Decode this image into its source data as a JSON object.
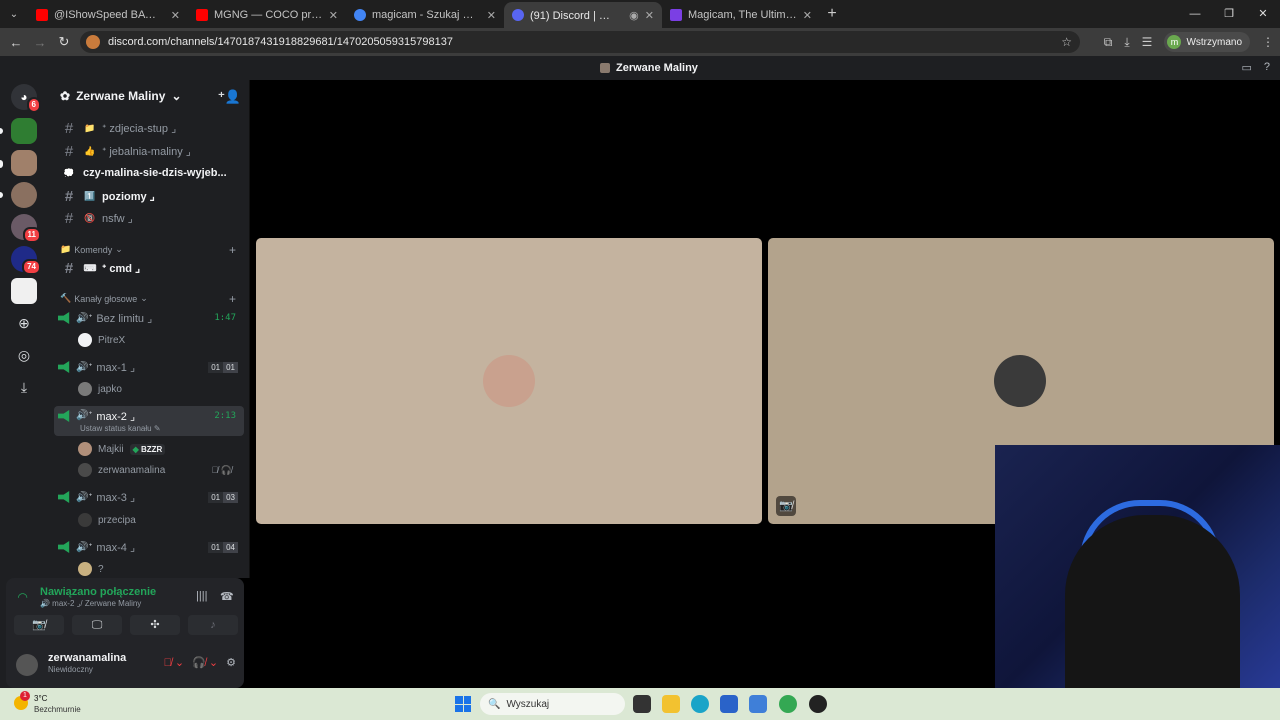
{
  "browser": {
    "tabs": [
      {
        "title": "@IShowSpeed BAWI SIĘ W WA",
        "color": "#ff0000"
      },
      {
        "title": "MGNG — COCO prod. MRGH",
        "color": "#ff0000"
      },
      {
        "title": "magicam - Szukaj w Google",
        "color": "#4285f4"
      },
      {
        "title": "(91) Discord | 🔊 max-2",
        "color": "#5865f2"
      },
      {
        "title": "Magicam, The Ultimate Real-Tim",
        "color": "#7b3fe4"
      }
    ],
    "url": "discord.com/channels/1470187431918829681/1470205059315798137",
    "profile_label": "Wstrzymano",
    "profile_initial": "m"
  },
  "discord": {
    "top_title": "Zerwane Maliny",
    "servers": [
      {
        "badge": "6"
      },
      {
        "badge": ""
      },
      {
        "badge": ""
      },
      {
        "badge": "11"
      },
      {
        "badge": "74"
      }
    ],
    "guild_name": "Zerwane Maliny",
    "text_channels": [
      {
        "emoji": "📁",
        "name": "ᐩ zdjecia-stup ⌟",
        "bold": false
      },
      {
        "emoji": "👍",
        "name": "ᐩ jebalnia-maliny ⌟",
        "bold": false
      },
      {
        "emoji": "💭",
        "name": "czy-malina-sie-dzis-wyjeb...",
        "bold": true
      },
      {
        "emoji": "1️⃣",
        "name": "poziomy ⌟",
        "bold": true
      },
      {
        "emoji": "🔞",
        "name": "nsfw ⌟",
        "bold": false
      }
    ],
    "category_commands": "Komendy",
    "cmd_channel": "ᐩ cmd ⌟",
    "category_voice": "Kanały głosowe",
    "voice_channels": [
      {
        "name": "Bez limitu ⌟",
        "timer": "1:47",
        "count": [],
        "users": [
          {
            "name": "PitreX"
          }
        ]
      },
      {
        "name": "max-1 ⌟",
        "timer": "",
        "count": [
          "01",
          "01"
        ],
        "users": [
          {
            "name": "japko"
          }
        ]
      },
      {
        "name": "max-2 ⌟",
        "timer": "2:13",
        "count": [],
        "status": "Ustaw status kanału",
        "users": [
          {
            "name": "Majkii",
            "tag": "BZZR"
          },
          {
            "name": "zerwanamalina"
          }
        ]
      },
      {
        "name": "max-3 ⌟",
        "timer": "",
        "count": [
          "01",
          "03"
        ],
        "users": [
          {
            "name": "przecipa"
          }
        ]
      },
      {
        "name": "max-4 ⌟",
        "timer": "",
        "count": [
          "01",
          "04"
        ],
        "users": [
          {
            "name": "?"
          }
        ]
      }
    ],
    "voice_panel": {
      "status": "Nawiązano połączenie",
      "sub": "🔊 max-2 ⌟/ Zerwane Maliny",
      "username": "zerwanamalina",
      "user_status": "Niewidoczny"
    },
    "tile_colors": [
      "#c4b39f",
      "#b3a38c"
    ]
  },
  "taskbar": {
    "temp": "3°C",
    "weather": "Bezchmurnie",
    "weather_badge": "1",
    "search_placeholder": "Wyszukaj"
  }
}
